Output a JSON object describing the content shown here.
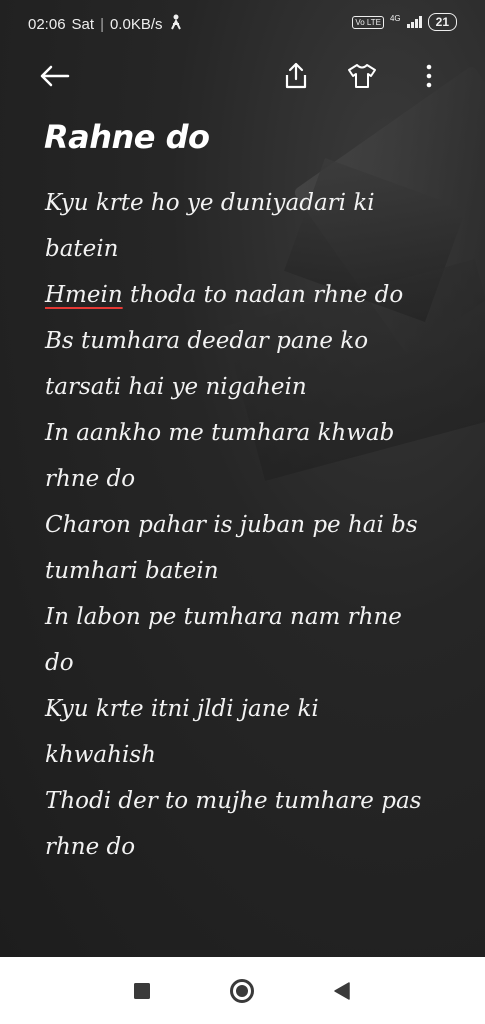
{
  "status_bar": {
    "time": "02:06",
    "day": "Sat",
    "separator": "|",
    "network_speed": "0.0KB/s",
    "volte": "Vo LTE",
    "network_type": "4G",
    "battery": "21"
  },
  "toolbar": {
    "back_icon": "arrow-left-icon",
    "share_icon": "share-icon",
    "theme_icon": "tshirt-icon",
    "more_icon": "more-vertical-icon"
  },
  "note": {
    "title": "Rahne do",
    "lines": [
      "Kyu krte ho ye duniyadari ki",
      "batein",
      "Hmein",
      " thoda to nadan rhne do",
      "Bs tumhara deedar pane ko",
      "tarsati hai ye nigahein",
      "In aankho me tumhara khwab",
      "rhne do",
      "Charon pahar is juban pe hai bs",
      "tumhari batein",
      "In labon pe tumhara nam rhne",
      "do",
      "Kyu krte itni jldi jane ki",
      "khwahish",
      "Thodi der to mujhe tumhare pas",
      "rhne do"
    ]
  },
  "nav_bar": {
    "recents_icon": "square-icon",
    "home_icon": "circle-icon",
    "back_icon": "triangle-back-icon"
  }
}
